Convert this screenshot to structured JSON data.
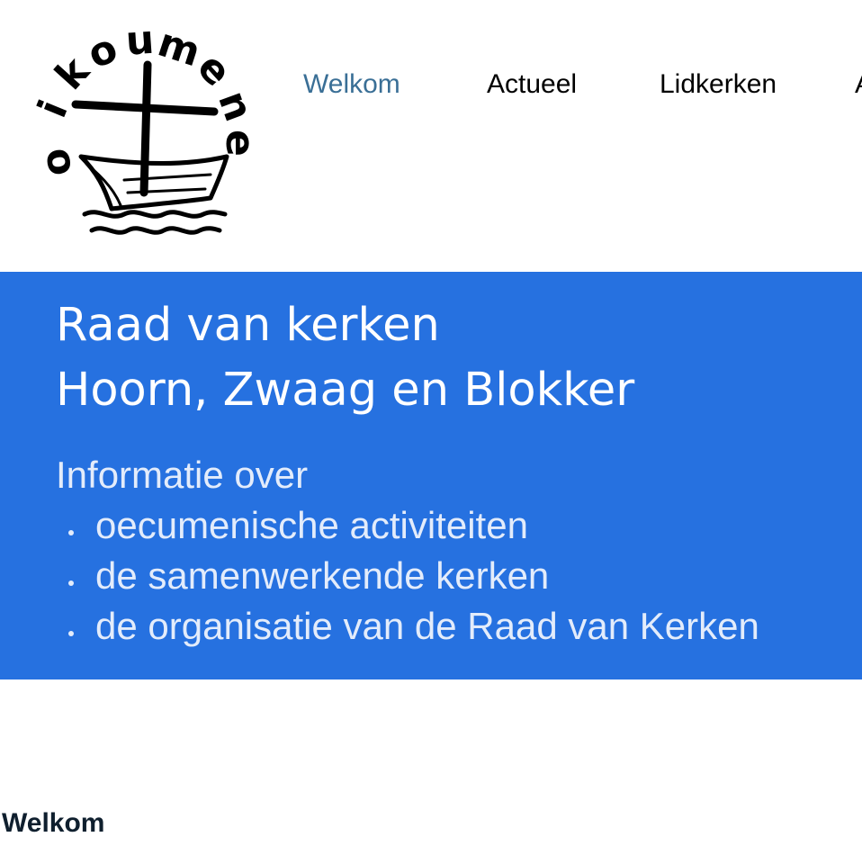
{
  "header": {
    "logo_icon": "oikoumene-boat-cross-icon",
    "logo_text": "oikoumene"
  },
  "nav": {
    "items": [
      {
        "label": "Welkom",
        "active": true
      },
      {
        "label": "Actueel",
        "active": false
      },
      {
        "label": "Lidkerken",
        "active": false
      },
      {
        "label": "A",
        "active": false
      }
    ],
    "active_color": "#3a6f96",
    "color": "#000000"
  },
  "hero": {
    "background": "#2671e0",
    "title_line1": "Raad van kerken",
    "title_line2": "Hoorn, Zwaag en Blokker",
    "intro": "Informatie over",
    "list": [
      "oecumenische activiteiten",
      "de samenwerkende kerken",
      "de organisatie van de Raad van Kerken"
    ]
  },
  "main": {
    "heading": "Welkom"
  }
}
